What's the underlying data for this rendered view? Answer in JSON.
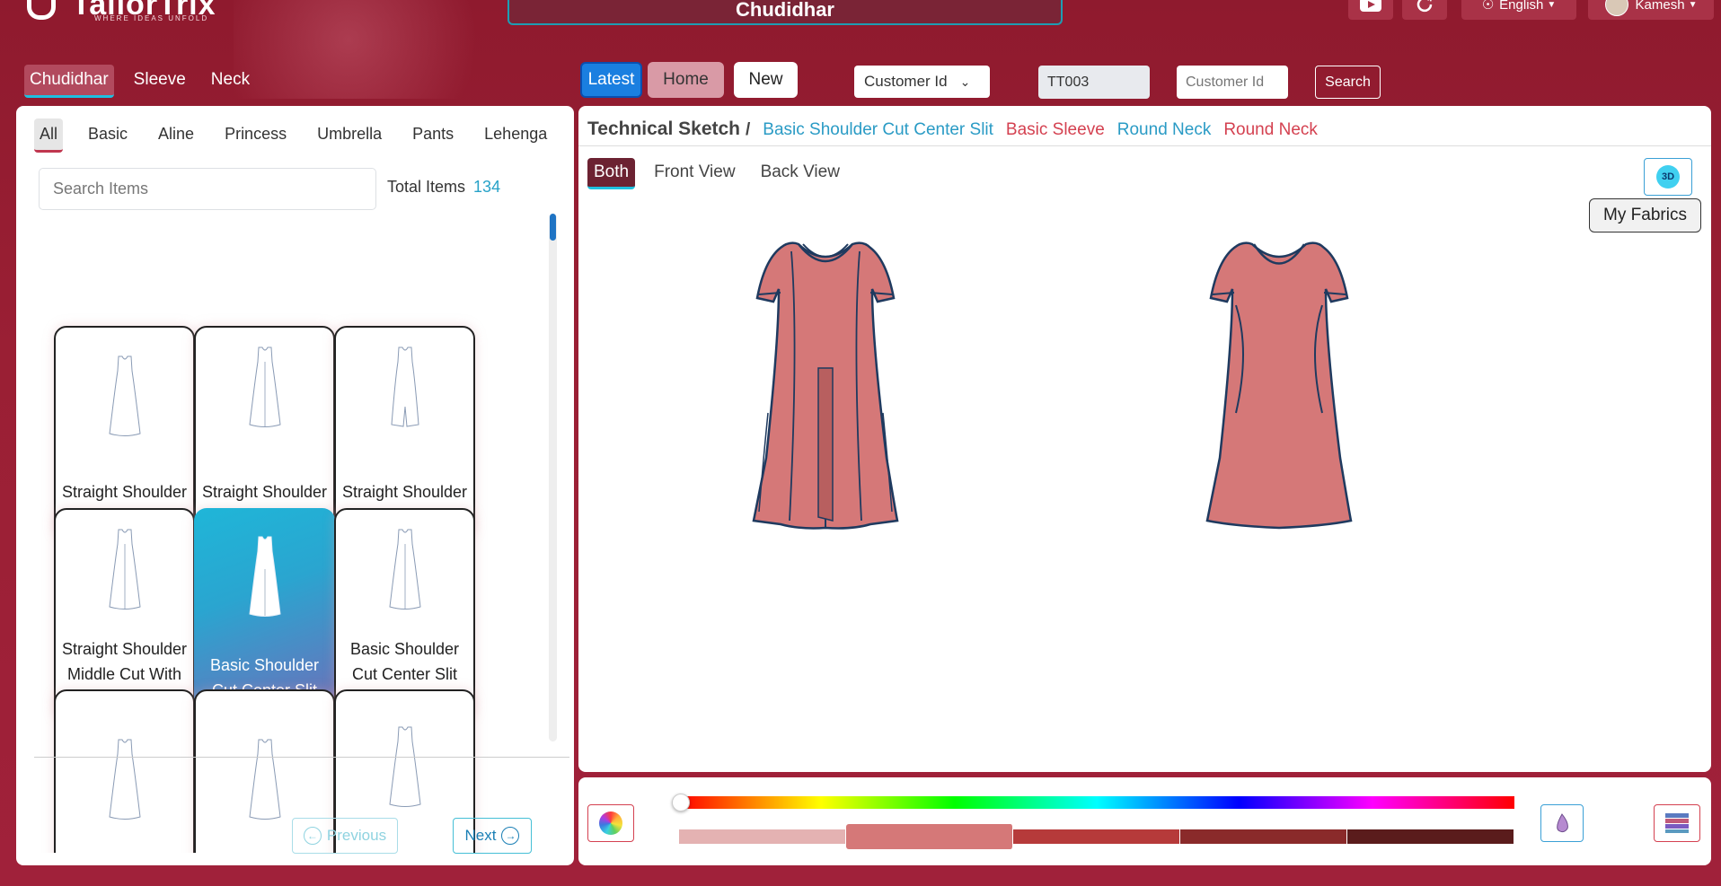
{
  "app": {
    "logo_text": "TailorTrix",
    "logo_tagline": "WHERE IDEAS UNFOLD",
    "page_title": "Chudidhar",
    "language": "English",
    "user_name": "Kamesh"
  },
  "categories": [
    {
      "label": "Chudidhar",
      "active": true
    },
    {
      "label": "Sleeve",
      "active": false
    },
    {
      "label": "Neck",
      "active": false
    }
  ],
  "toolbar": {
    "latest_label": "Latest",
    "home_label": "Home",
    "new_label": "New",
    "customer_select": "Customer Id",
    "customer_value": "TT003",
    "customer_placeholder": "Customer Id",
    "search_label": "Search"
  },
  "style_tabs": [
    "All",
    "Basic",
    "Aline",
    "Princess",
    "Umbrella",
    "Pants",
    "Lehenga"
  ],
  "left": {
    "search_placeholder": "Search Items",
    "total_label": "Total Items",
    "total_count": "134",
    "items": [
      "Straight Shoulder Cut",
      "Straight Shoulder Cut With FO",
      "Straight Shoulder WIth Middle",
      "Straight Shoulder Middle Cut With FO",
      "Basic Shoulder Cut Center Slit",
      "Basic Shoulder Cut Center Slit FB",
      "",
      "",
      ""
    ],
    "selected_index": 4,
    "prev_label": "Previous",
    "next_label": "Next"
  },
  "sketch": {
    "title": "Technical Sketch",
    "separator": "/",
    "breadcrumb": [
      "Basic Shoulder Cut Center Slit",
      "Basic Sleeve",
      "Round Neck",
      "Round Neck"
    ],
    "views": [
      "Both",
      "Front View",
      "Back View"
    ],
    "active_view": "Both",
    "btn_3d": "3D",
    "fabrics_label": "My Fabrics",
    "garment_color": "#d57878",
    "outline_color": "#1f3a5f"
  },
  "palette": {
    "shades": [
      "#e4b2b2",
      "#d57878",
      "#b63a3a",
      "#8a2a2a",
      "#5a1c1c"
    ],
    "selected_shade": 1
  },
  "icons": {
    "youtube": "youtube-icon",
    "refresh": "refresh-icon",
    "globe": "globe-icon",
    "color_wheel": "color-wheel-icon",
    "dropper": "dropper-icon",
    "swatches": "swatch-grid-icon"
  }
}
